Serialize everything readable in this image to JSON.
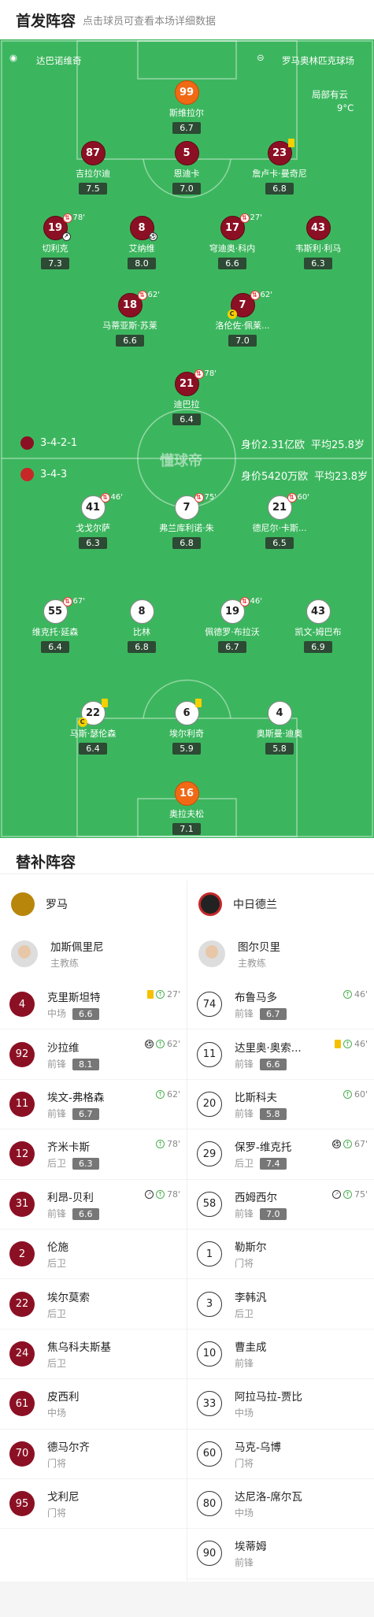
{
  "header": {
    "title": "首发阵容",
    "subtitle": "点击球员可查看本场详细数据"
  },
  "pitch": {
    "team_left": "达巴诺维奇",
    "stadium": "罗马奥林匹克球场",
    "weather": "局部有云",
    "temp": "9°C",
    "watermark": "懂球帝",
    "home": {
      "formation": "3-4-2-1",
      "value": "身价2.31亿欧",
      "age": "平均25.8岁",
      "color": "#8c1024"
    },
    "away": {
      "formation": "3-4-3",
      "value": "身价5420万欧",
      "age": "平均23.8岁",
      "color": "#c62828"
    },
    "players": [
      {
        "id": "p1",
        "num": "99",
        "name": "斯维拉尔",
        "rating": "6.7",
        "kind": "or"
      },
      {
        "id": "p2",
        "num": "87",
        "name": "吉拉尔迪",
        "rating": "7.5",
        "kind": "red"
      },
      {
        "id": "p3",
        "num": "5",
        "name": "恩迪卡",
        "rating": "7.0",
        "kind": "red"
      },
      {
        "id": "p4",
        "num": "23",
        "name": "詹卢卡·曼奇尼",
        "rating": "6.8",
        "kind": "red",
        "yellow": true
      },
      {
        "id": "p5",
        "num": "19",
        "name": "切利克",
        "rating": "7.3",
        "kind": "red",
        "sub": "78'",
        "assist": true
      },
      {
        "id": "p6",
        "num": "8",
        "name": "艾纳维",
        "rating": "8.0",
        "kind": "red",
        "goal": true
      },
      {
        "id": "p7",
        "num": "17",
        "name": "穹迪奥·科内",
        "rating": "6.6",
        "kind": "red",
        "sub": "27'"
      },
      {
        "id": "p8",
        "num": "43",
        "name": "韦斯利·利马",
        "rating": "6.3",
        "kind": "red"
      },
      {
        "id": "p9",
        "num": "18",
        "name": "马蒂亚斯·苏莱",
        "rating": "6.6",
        "kind": "red",
        "sub": "62'"
      },
      {
        "id": "p10",
        "num": "7",
        "name": "洛伦佐·佩莱...",
        "rating": "7.0",
        "kind": "red",
        "sub": "62'",
        "captain": true
      },
      {
        "id": "p11",
        "num": "21",
        "name": "迪巴拉",
        "rating": "6.4",
        "kind": "red",
        "sub": "78'"
      },
      {
        "id": "p12",
        "num": "41",
        "name": "戈戈尔萨",
        "rating": "6.3",
        "kind": "wh",
        "sub": "46'"
      },
      {
        "id": "p13",
        "num": "7",
        "name": "弗兰库利诺·朱",
        "rating": "6.8",
        "kind": "wh",
        "sub": "75'"
      },
      {
        "id": "p14",
        "num": "21",
        "name": "德尼尔·卡斯...",
        "rating": "6.5",
        "kind": "wh",
        "sub": "60'"
      },
      {
        "id": "p15",
        "num": "55",
        "name": "维克托·延森",
        "rating": "6.4",
        "kind": "wh",
        "sub": "67'"
      },
      {
        "id": "p16",
        "num": "8",
        "name": "比林",
        "rating": "6.8",
        "kind": "wh"
      },
      {
        "id": "p17",
        "num": "19",
        "name": "佩德罗·布拉沃",
        "rating": "6.7",
        "kind": "wh",
        "sub": "46'"
      },
      {
        "id": "p18",
        "num": "43",
        "name": "凯文-姆巴布",
        "rating": "6.9",
        "kind": "wh"
      },
      {
        "id": "p19",
        "num": "22",
        "name": "马斯·瑟伦森",
        "rating": "6.4",
        "kind": "wh",
        "yellow": true,
        "captain": true
      },
      {
        "id": "p20",
        "num": "6",
        "name": "埃尔利奇",
        "rating": "5.9",
        "kind": "wh",
        "yellow": true
      },
      {
        "id": "p21",
        "num": "4",
        "name": "奥斯曼·迪奥",
        "rating": "5.8",
        "kind": "wh"
      },
      {
        "id": "p22",
        "num": "16",
        "name": "奥拉夫松",
        "rating": "7.1",
        "kind": "or"
      }
    ]
  },
  "subs": {
    "title": "替补阵容",
    "home": {
      "team": "罗马",
      "coach": "加斯佩里尼",
      "coach_role": "主教练",
      "players": [
        {
          "num": "4",
          "name": "克里斯坦特",
          "pos": "中场",
          "rating": "6.6",
          "ev": "27'",
          "yellow": true
        },
        {
          "num": "92",
          "name": "沙拉维",
          "pos": "前锋",
          "rating": "8.1",
          "ev": "62'",
          "goal": true
        },
        {
          "num": "11",
          "name": "埃文-弗格森",
          "pos": "前锋",
          "rating": "6.7",
          "ev": "62'"
        },
        {
          "num": "12",
          "name": "齐米卡斯",
          "pos": "后卫",
          "rating": "6.3",
          "ev": "78'"
        },
        {
          "num": "31",
          "name": "利昂-贝利",
          "pos": "前锋",
          "rating": "6.6",
          "ev": "78'",
          "assist": true
        },
        {
          "num": "2",
          "name": "伦施",
          "pos": "后卫"
        },
        {
          "num": "22",
          "name": "埃尔莫索",
          "pos": "后卫"
        },
        {
          "num": "24",
          "name": "焦乌科夫斯基",
          "pos": "后卫"
        },
        {
          "num": "61",
          "name": "皮西利",
          "pos": "中场"
        },
        {
          "num": "70",
          "name": "德马尔齐",
          "pos": "门将"
        },
        {
          "num": "95",
          "name": "戈利尼",
          "pos": "门将"
        }
      ]
    },
    "away": {
      "team": "中日德兰",
      "coach": "图尔贝里",
      "coach_role": "主教练",
      "players": [
        {
          "num": "74",
          "name": "布鲁马多",
          "pos": "前锋",
          "rating": "6.7",
          "ev": "46'"
        },
        {
          "num": "11",
          "name": "达里奥·奥索...",
          "pos": "前锋",
          "rating": "6.6",
          "ev": "46'",
          "yellow": true
        },
        {
          "num": "20",
          "name": "比斯科夫",
          "pos": "前锋",
          "rating": "5.8",
          "ev": "60'"
        },
        {
          "num": "29",
          "name": "保罗-维克托",
          "pos": "后卫",
          "rating": "7.4",
          "ev": "67'",
          "goal": true
        },
        {
          "num": "58",
          "name": "西姆西尔",
          "pos": "前锋",
          "rating": "7.0",
          "ev": "75'",
          "assist": true
        },
        {
          "num": "1",
          "name": "勒斯尔",
          "pos": "门将"
        },
        {
          "num": "3",
          "name": "李韩汎",
          "pos": "后卫"
        },
        {
          "num": "10",
          "name": "曹圭成",
          "pos": "前锋"
        },
        {
          "num": "33",
          "name": "阿拉马拉-贾比",
          "pos": "中场"
        },
        {
          "num": "60",
          "name": "马克-乌博",
          "pos": "门将"
        },
        {
          "num": "80",
          "name": "达尼洛-席尔瓦",
          "pos": "中场"
        },
        {
          "num": "90",
          "name": "埃蒂姆",
          "pos": "前锋"
        }
      ]
    }
  }
}
